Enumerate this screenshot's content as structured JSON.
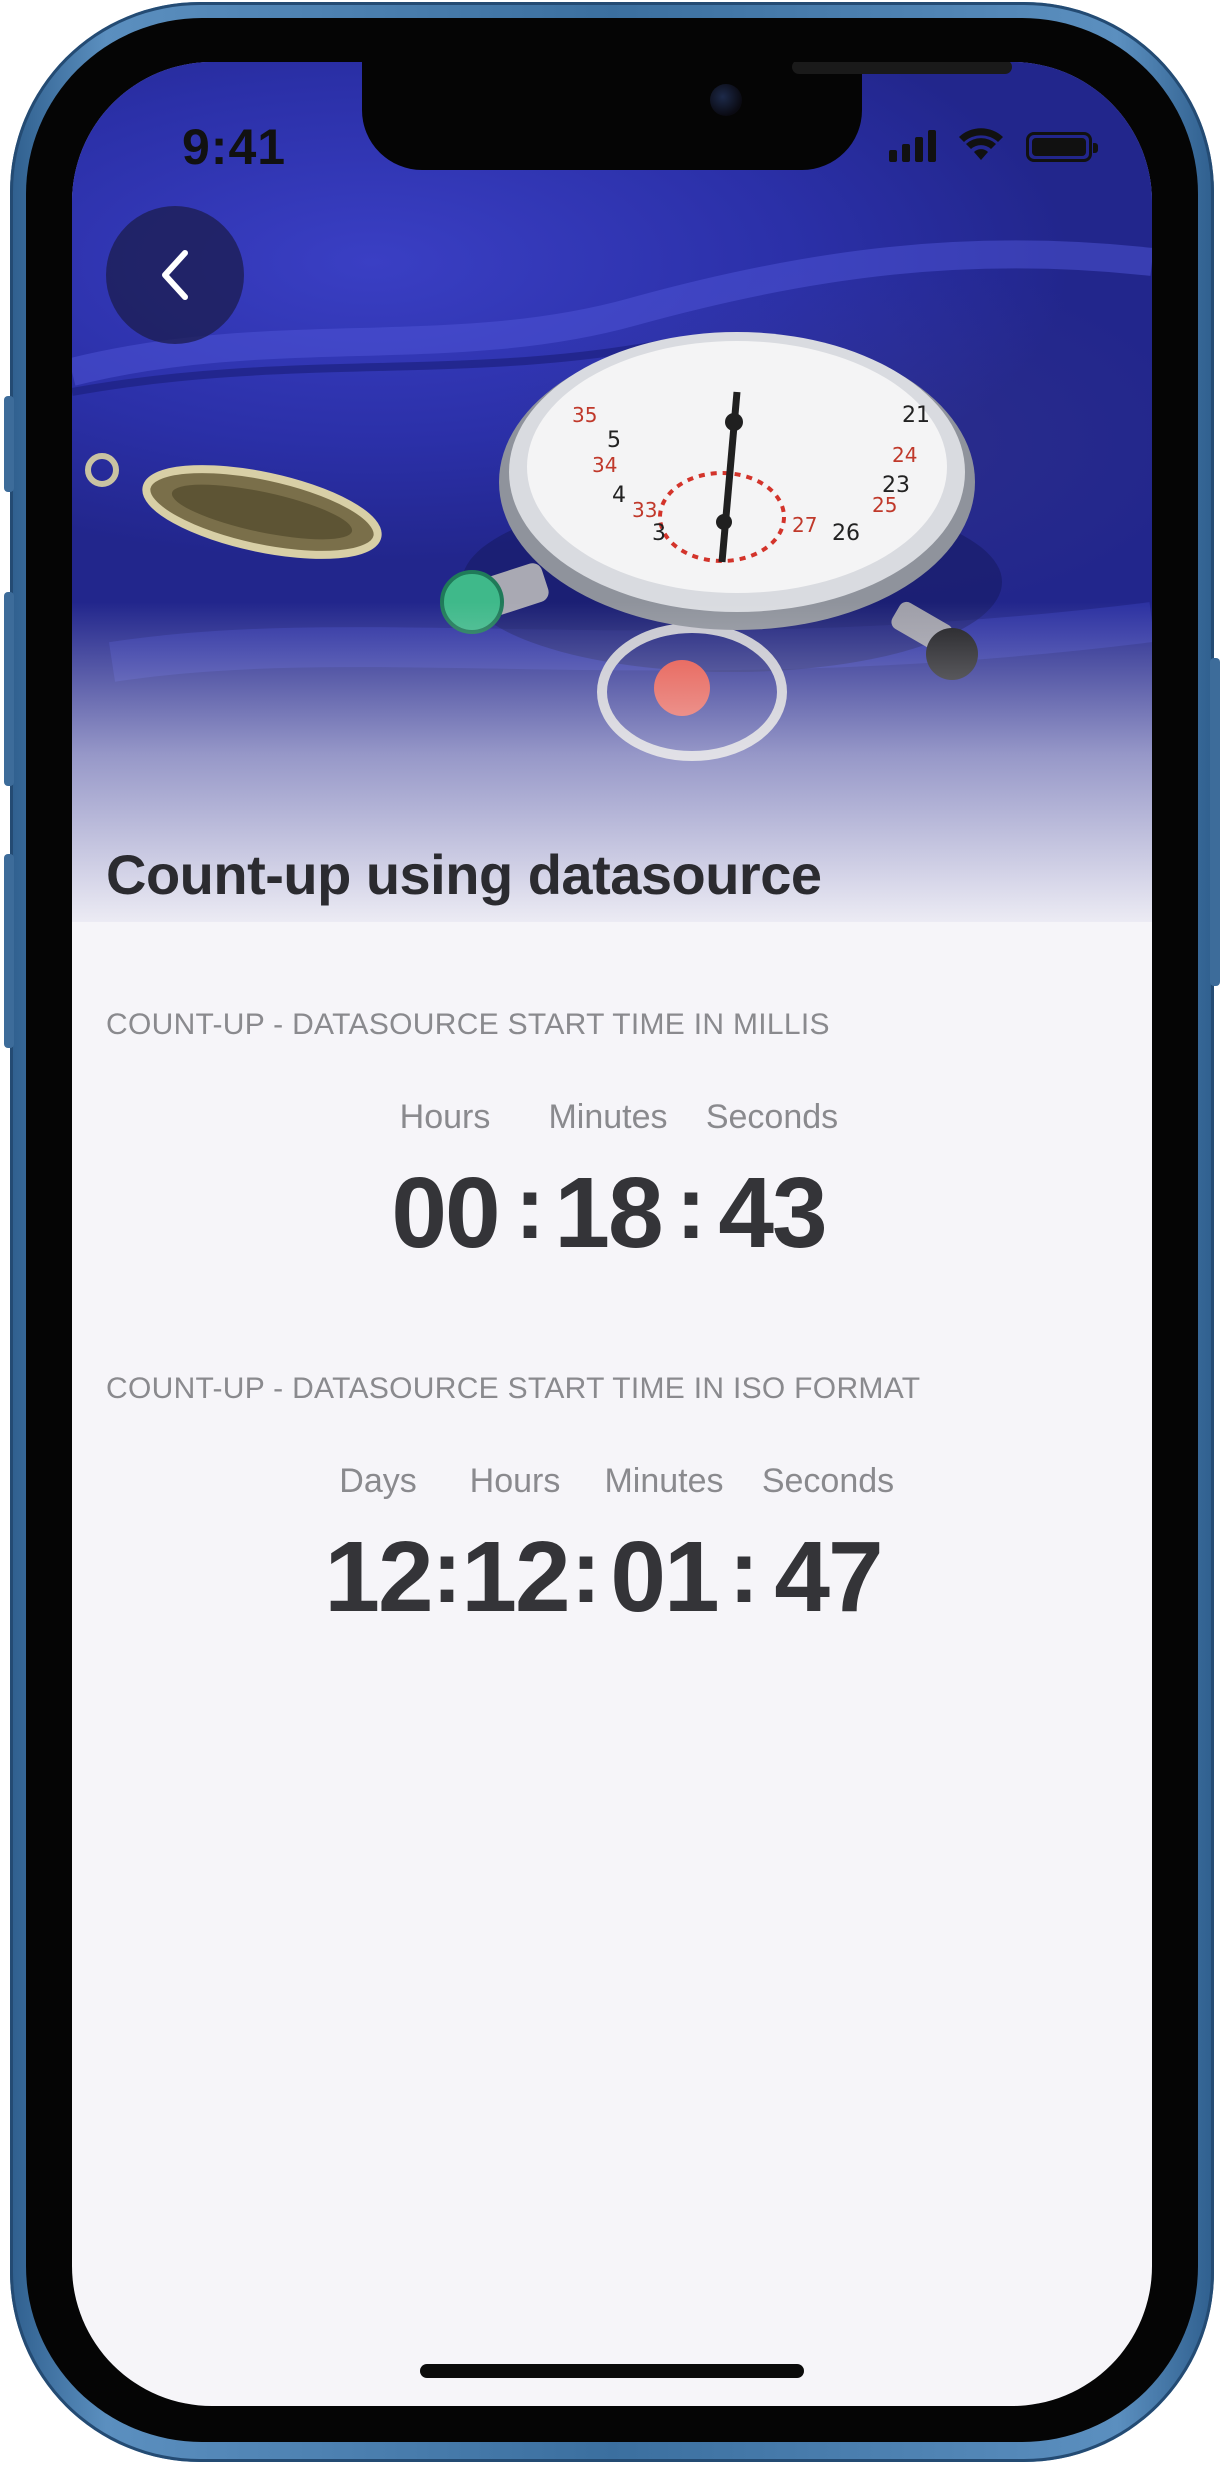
{
  "status_bar": {
    "time": "9:41",
    "icons": [
      "signal-icon",
      "wifi-icon",
      "battery-icon"
    ]
  },
  "header": {
    "back_icon": "chevron-left-icon",
    "title": "Count-up using datasource"
  },
  "sections": [
    {
      "label": "COUNT-UP - DATASOURCE START TIME IN MILLIS",
      "units": [
        "Hours",
        "Minutes",
        "Seconds"
      ],
      "values": [
        "00",
        "18",
        "43"
      ]
    },
    {
      "label": "COUNT-UP - DATASOURCE START TIME IN ISO FORMAT",
      "units": [
        "Days",
        "Hours",
        "Minutes",
        "Seconds"
      ],
      "values": [
        "12",
        "12",
        "01",
        "47"
      ]
    }
  ],
  "colors": {
    "background": "#f6f5f9",
    "hero_blue": "#2c31a9",
    "text_dark": "#343438",
    "text_muted": "#8a8a8e",
    "frame_blue": "#3b6f9f"
  }
}
